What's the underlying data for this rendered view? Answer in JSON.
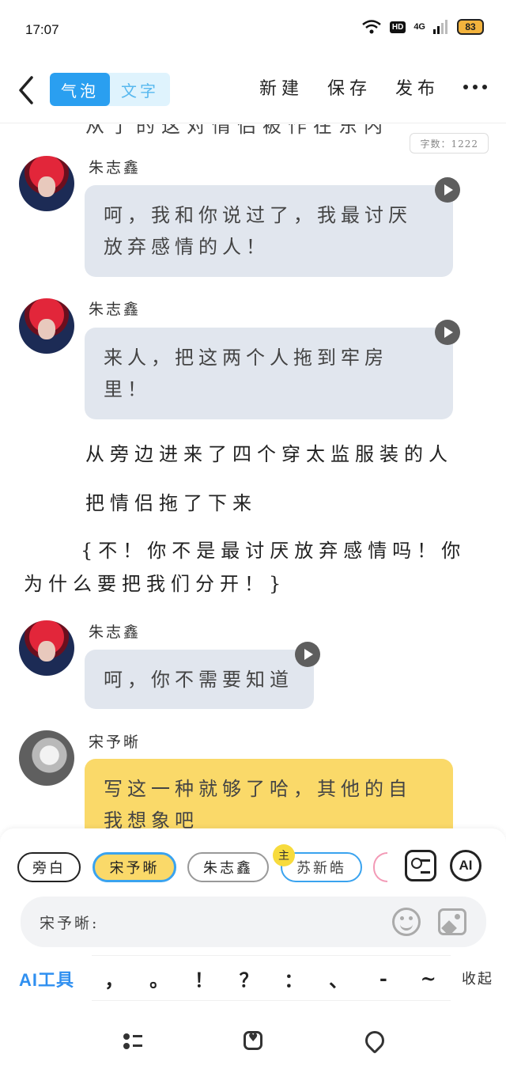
{
  "status_bar": {
    "time": "17:07",
    "hd_label": "HD",
    "network_label": "4G",
    "battery_level": "83"
  },
  "top_bar": {
    "mode_bubble_label": "气泡",
    "mode_text_label": "文字",
    "new_label": "新建",
    "save_label": "保存",
    "publish_label": "发布"
  },
  "content": {
    "word_count_label": "字数：1222",
    "cutoff_text": "从了的这对情侣被作在东内",
    "messages": [
      {
        "speaker": "朱志鑫",
        "lines": [
          "呵，我和你说过了，我最讨厌",
          "放弃感情的人！"
        ]
      },
      {
        "speaker": "朱志鑫",
        "lines": [
          "来人，把这两个人拖到牢房",
          "里！"
        ]
      },
      {
        "speaker": "朱志鑫",
        "lines": [
          "呵，你不需要知道"
        ]
      },
      {
        "speaker": "宋予晰",
        "lines": [
          "写这一种就够了哈，其他的自",
          "我想象吧"
        ]
      }
    ],
    "narration": [
      "从旁边进来了四个穿太监服装的人",
      "把情侣拖了下来",
      "{不！你不是最讨厌放弃感情吗！你",
      "为什么要把我们分开！}"
    ]
  },
  "bottom_panel": {
    "roles": [
      "旁白",
      "宋予晰",
      "朱志鑫",
      "苏新皓"
    ],
    "selected_role": "宋予晰",
    "main_badge": "主",
    "ai_button_label": "AI",
    "input_label": "宋予晰:",
    "ai_tools_label": "AI工具",
    "punctuation": [
      "，",
      "。",
      "！",
      "？",
      "：",
      "、",
      "-",
      "~"
    ],
    "collapse_label": "收起"
  },
  "colors": {
    "accent_blue": "#2a9ff0",
    "bubble_gray": "#e1e6ee",
    "bubble_yellow": "#fad969"
  }
}
